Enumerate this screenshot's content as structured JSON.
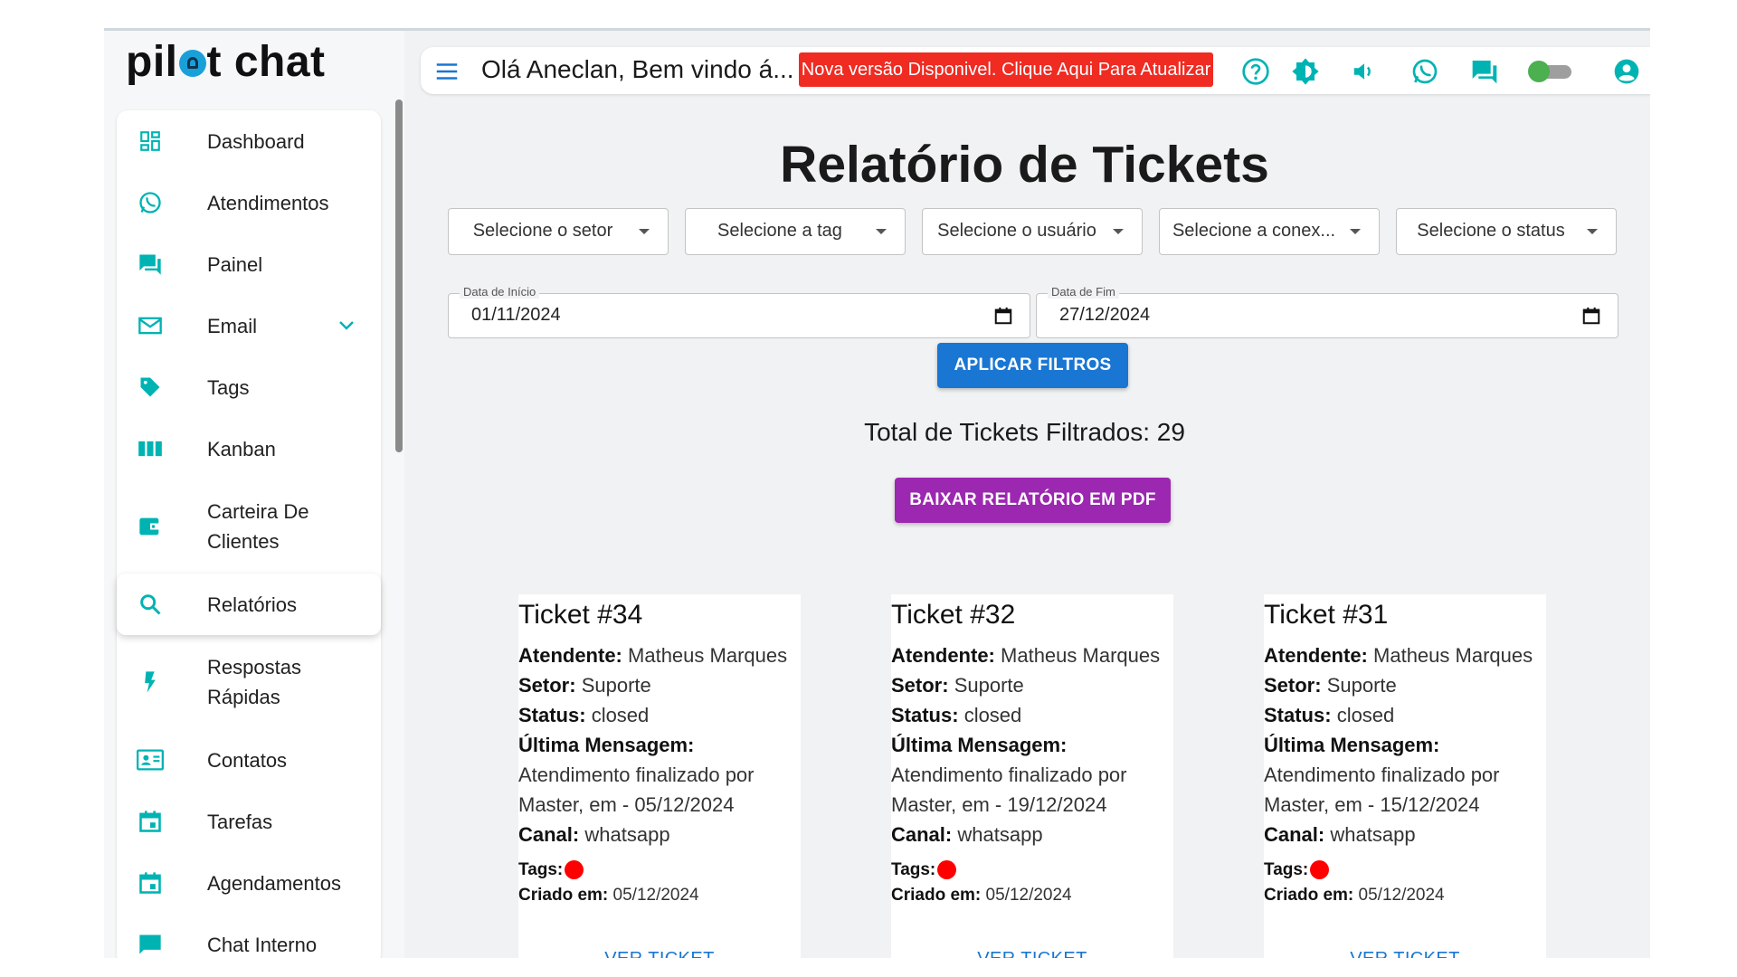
{
  "brand": {
    "logo_left": "pil",
    "logo_right": "t chat"
  },
  "sidebar": {
    "items": [
      {
        "label": "Dashboard",
        "icon": "dashboard-icon"
      },
      {
        "label": "Atendimentos",
        "icon": "whatsapp-icon"
      },
      {
        "label": "Painel",
        "icon": "forum-icon"
      },
      {
        "label": "Email",
        "icon": "mail-icon"
      },
      {
        "label": "Tags",
        "icon": "tag-icon"
      },
      {
        "label": "Kanban",
        "icon": "kanban-icon"
      },
      {
        "label": "Carteira De Clientes",
        "icon": "wallet-icon"
      },
      {
        "label": "Relatórios",
        "icon": "search-icon",
        "active": true
      },
      {
        "label": "Respostas Rápidas",
        "icon": "flash-icon"
      },
      {
        "label": "Contatos",
        "icon": "contacts-icon"
      },
      {
        "label": "Tarefas",
        "icon": "calendar-icon"
      },
      {
        "label": "Agendamentos",
        "icon": "calendar-icon"
      },
      {
        "label": "Chat Interno",
        "icon": "chat-icon"
      }
    ]
  },
  "header": {
    "greeting": "Olá Aneclan, Bem vindo á...",
    "update_banner": "Nova versão Disponivel. Clique Aqui Para Atualizar"
  },
  "main": {
    "title": "Relatório de Tickets",
    "filters": [
      {
        "placeholder": "Selecione o setor"
      },
      {
        "placeholder": "Selecione a tag"
      },
      {
        "placeholder": "Selecione o usuário"
      },
      {
        "placeholder": "Selecione a conex..."
      },
      {
        "placeholder": "Selecione o status"
      }
    ],
    "start_date": {
      "label": "Data de Início",
      "value": "01/11/2024"
    },
    "end_date": {
      "label": "Data de Fim",
      "value": "27/12/2024"
    },
    "apply_label": "APLICAR FILTROS",
    "total_text": "Total de Tickets Filtrados: 29",
    "pdf_label": "BAIXAR RELATÓRIO EM PDF"
  },
  "labels": {
    "atendente": "Atendente:",
    "setor": "Setor:",
    "status": "Status:",
    "ultima": "Última Mensagem:",
    "canal": "Canal:",
    "tags": "Tags:",
    "criado": "Criado em:",
    "ver": "VER TICKET"
  },
  "tickets": [
    {
      "title": "Ticket #34",
      "atendente": "Matheus Marques",
      "setor": "Suporte",
      "status": "closed",
      "msg1": "Atendimento finalizado por",
      "msg2": "Master, em - 05/12/2024",
      "canal": "whatsapp",
      "criado": "05/12/2024"
    },
    {
      "title": "Ticket #32",
      "atendente": "Matheus Marques",
      "setor": "Suporte",
      "status": "closed",
      "msg1": "Atendimento finalizado por",
      "msg2": "Master, em - 19/12/2024",
      "canal": "whatsapp",
      "criado": "05/12/2024"
    },
    {
      "title": "Ticket #31",
      "atendente": "Matheus Marques",
      "setor": "Suporte",
      "status": "closed",
      "msg1": "Atendimento finalizado por",
      "msg2": "Master, em - 15/12/2024",
      "canal": "whatsapp",
      "criado": "05/12/2024"
    }
  ],
  "colors": {
    "accent": "#1976d2",
    "teal": "#00b3b3",
    "banner": "#ef2b22",
    "pdf": "#9c27b0",
    "tag": "#ff0000"
  }
}
